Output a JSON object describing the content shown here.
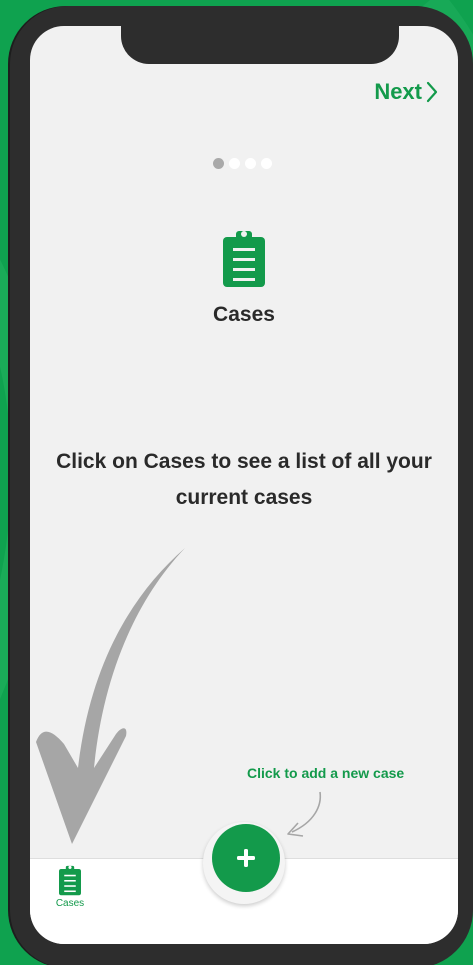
{
  "header": {
    "next_label": "Next"
  },
  "pager": {
    "total": 4,
    "current": 1
  },
  "hero": {
    "icon": "clipboard-icon",
    "title": "Cases"
  },
  "description": "Click on Cases to see a list of all your current cases",
  "hint": {
    "add_case": "Click to add a new case"
  },
  "fab": {
    "icon": "plus-icon"
  },
  "tabbar": {
    "items": [
      {
        "label": "Cases",
        "icon": "clipboard-icon",
        "active": true
      }
    ]
  },
  "colors": {
    "brand_green": "#139a4b",
    "background_green": "#0fa24f",
    "frame": "#2d2d2d",
    "screen_bg": "#f1f1f1",
    "text_dark": "#2a2a2a",
    "arrow_gray": "#a6a6a6"
  }
}
